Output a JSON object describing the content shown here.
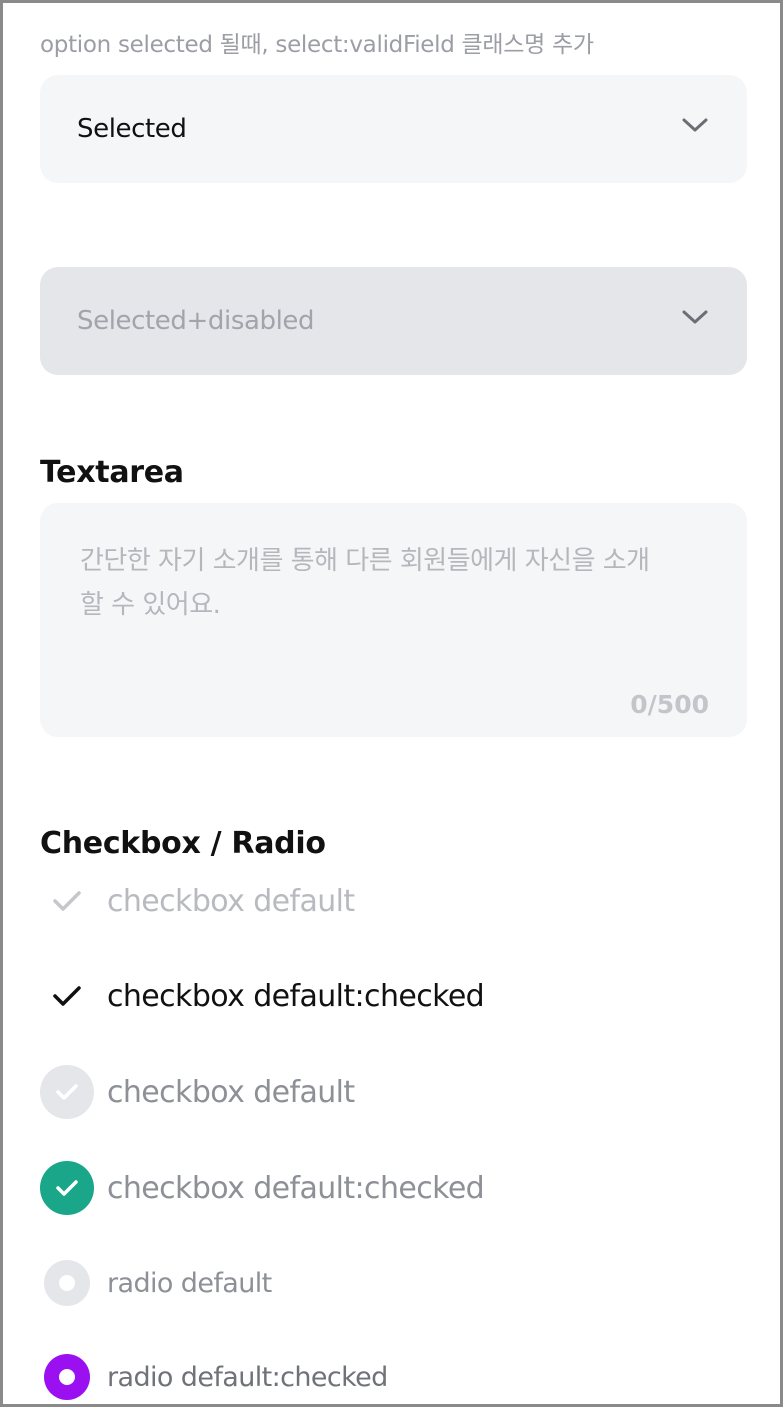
{
  "hint": "option selected 될때, select:validField 클래스명 추가",
  "select_selected": {
    "value": "Selected",
    "icon": "chevron-down-icon"
  },
  "select_disabled": {
    "value": "Selected+disabled",
    "icon": "chevron-down-icon"
  },
  "textarea_section": {
    "title": "Textarea",
    "placeholder_line1": "간단한 자기 소개를 통해 다른 회원들에게 자신을 소개",
    "placeholder_line2": "할 수 있어요.",
    "counter": "0/500"
  },
  "checkbox_section": {
    "title": "Checkbox / Radio",
    "items": [
      {
        "label": "checkbox default",
        "icon": "check-icon",
        "checked": false
      },
      {
        "label": "checkbox default:checked",
        "icon": "check-icon",
        "checked": true
      },
      {
        "label": "checkbox default",
        "icon": "circle-check-icon",
        "checked": false
      },
      {
        "label": "checkbox default:checked",
        "icon": "circle-check-icon",
        "checked": true
      },
      {
        "label": "radio default",
        "icon": "radio-icon",
        "checked": false
      },
      {
        "label": "radio default:checked",
        "icon": "radio-icon",
        "checked": true
      }
    ]
  },
  "colors": {
    "accent_green": "#1aa689",
    "accent_purple": "#9b10f0",
    "disabled_grey": "#e4e6ea"
  }
}
